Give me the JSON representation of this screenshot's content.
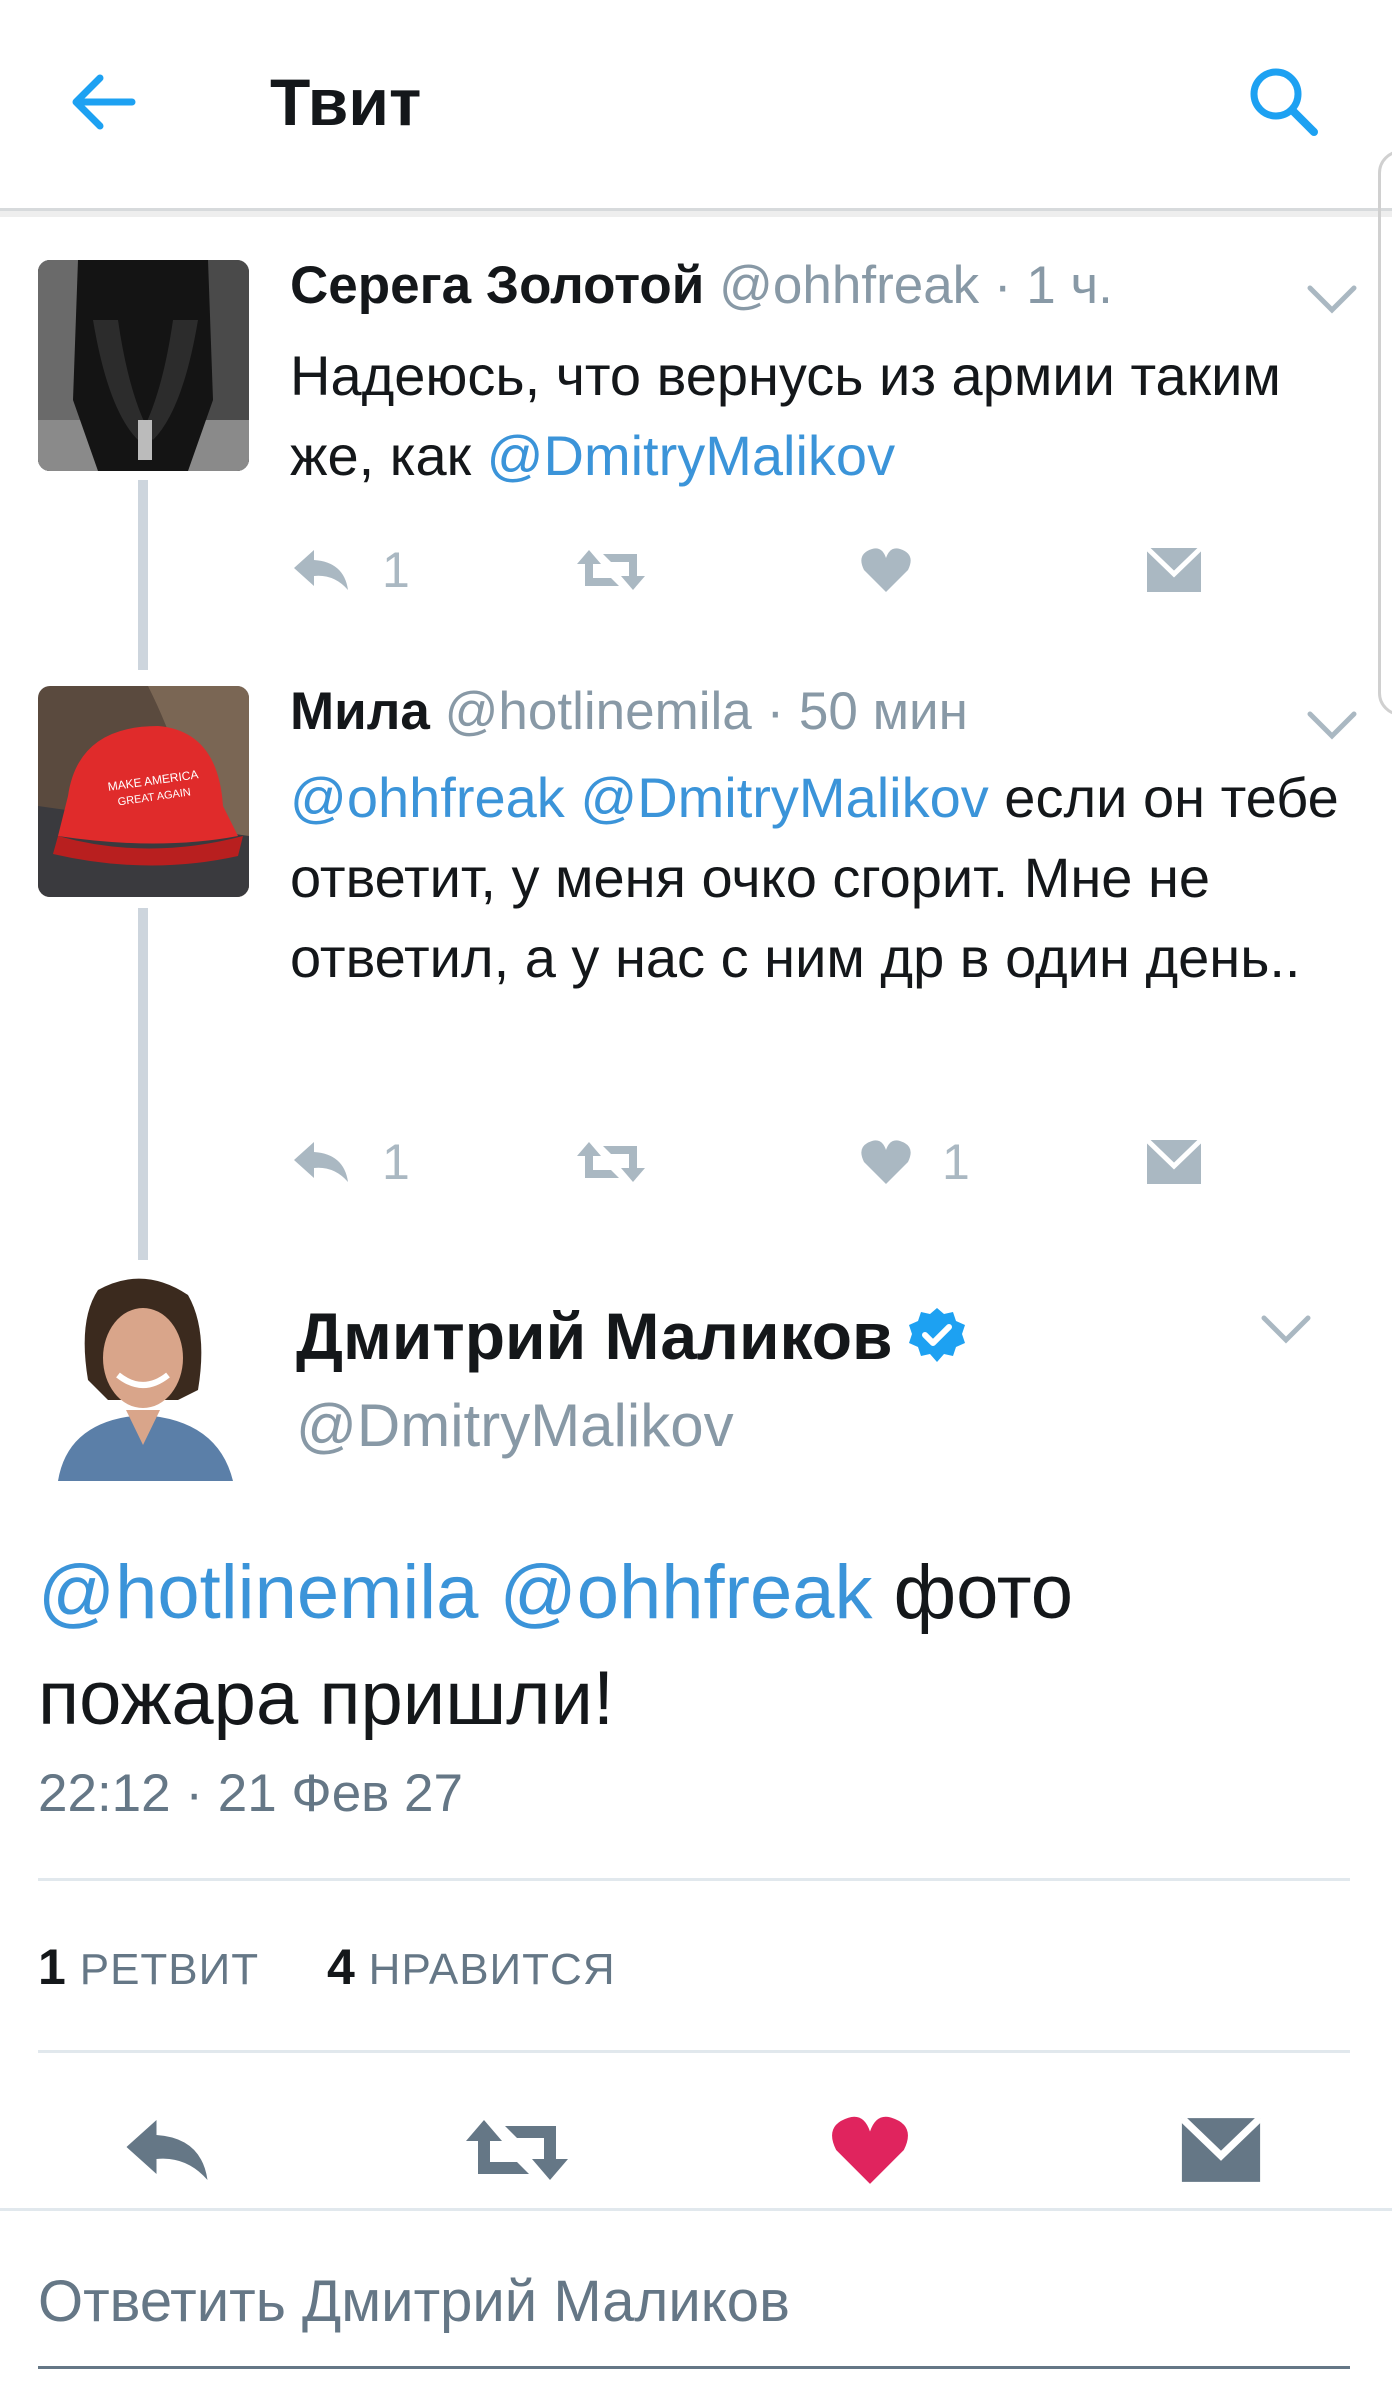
{
  "header": {
    "title": "Твит",
    "back_icon": "arrow-left-icon",
    "search_icon": "search-icon"
  },
  "colors": {
    "accent": "#1da1f2",
    "mention": "#3b94d9",
    "like": "#e0245e",
    "muted": "#8899a6",
    "icon": "#aab8c2"
  },
  "thread": [
    {
      "name": "Серега Золотой",
      "handle": "@ohhfreak",
      "time": "1 ч.",
      "text_parts": [
        {
          "text": "Надеюсь, что вернусь из армии таким же, как ",
          "mention": false
        },
        {
          "text": "@DmitryMalikov",
          "mention": true
        }
      ],
      "reply_count": "1",
      "like_count": ""
    },
    {
      "name": "Мила",
      "handle": "@hotlinemila",
      "time": "50 мин",
      "text_parts": [
        {
          "text": "@ohhfreak",
          "mention": true
        },
        {
          "text": " ",
          "mention": false
        },
        {
          "text": "@DmitryMalikov",
          "mention": true
        },
        {
          "text": " если он тебе ответит, у меня очко сгорит. Мне не ответил, а у нас с ним др в один день..",
          "mention": false
        }
      ],
      "reply_count": "1",
      "like_count": "1"
    }
  ],
  "main": {
    "name": "Дмитрий Маликов",
    "verified": true,
    "handle": "@DmitryMalikov",
    "mention_1": "@hotlinemila",
    "mention_2": "@ohhfreak",
    "text_rest": " фото пожара пришли!",
    "time": "22:12 · 21 Фев 27",
    "retweets": "1",
    "retweets_label": "РЕТВИТ",
    "likes": "4",
    "likes_label": "НРАВИТСЯ",
    "liked": true
  },
  "reply": {
    "placeholder": "Ответить Дмитрий Маликов"
  }
}
